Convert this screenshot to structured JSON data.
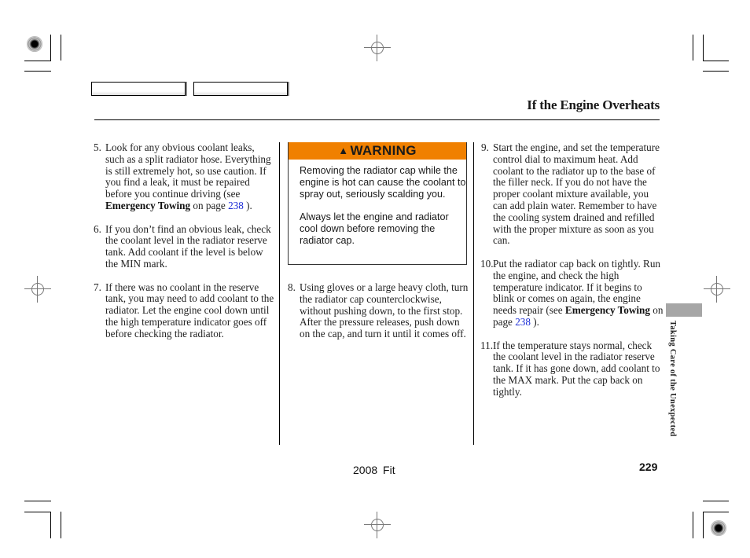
{
  "header": {
    "title": "If the Engine Overheats",
    "nav_buttons": [
      {
        "label": ""
      },
      {
        "label": ""
      }
    ]
  },
  "columns": {
    "left": [
      {
        "num": "5.",
        "parts": [
          {
            "t": "Look for any obvious coolant leaks, such as a split radiator hose. Everything is still extremely hot, so use caution. If you find a leak, it must be repaired before you continue driving (see "
          },
          {
            "b": "Emergency Towing"
          },
          {
            "t": " on page "
          },
          {
            "link": "238"
          },
          {
            "t": " )."
          }
        ]
      },
      {
        "num": "6.",
        "parts": [
          {
            "t": "If you don’t find an obvious leak, check the coolant level in the radiator reserve tank. Add coolant if the level is below the MIN mark."
          }
        ]
      },
      {
        "num": "7.",
        "parts": [
          {
            "t": "If there was no coolant in the reserve tank, you may need to add coolant to the radiator. Let the engine cool down until the high temperature indicator goes off before checking the radiator."
          }
        ]
      }
    ],
    "middle": [
      {
        "num": "8.",
        "parts": [
          {
            "t": "Using gloves or a large heavy cloth, turn the radiator cap counterclockwise, without pushing down, to the first stop. After the pressure releases, push down on the cap, and turn it until it comes off."
          }
        ]
      }
    ],
    "right": [
      {
        "num": "9.",
        "parts": [
          {
            "t": "Start the engine, and set the temperature control dial to maximum heat. Add coolant to the radiator up to the base of the filler neck. If you do not have the proper coolant mixture available, you can add plain water. Remember to have the cooling system drained and refilled with the proper mixture as soon as you can."
          }
        ]
      },
      {
        "num": "10.",
        "parts": [
          {
            "t": "Put the radiator cap back on tightly. Run the engine, and check the high temperature indicator. If it begins to blink or comes on again, the engine needs repair (see "
          },
          {
            "b": "Emergency Towing"
          },
          {
            "t": " on page "
          },
          {
            "link": "238"
          },
          {
            "t": " )."
          }
        ]
      },
      {
        "num": "11.",
        "parts": [
          {
            "t": "If the temperature stays normal, check the coolant level in the radiator reserve tank. If it has gone down, add coolant to the MAX mark. Put the cap back on tightly."
          }
        ]
      }
    ]
  },
  "warning": {
    "icon": "warning-triangle-icon",
    "title": "WARNING",
    "paragraphs": [
      "Removing the radiator cap while the engine is hot can cause the coolant to spray out, seriously scalding you.",
      "Always let the engine and radiator cool down before removing the radiator cap."
    ]
  },
  "side_tab": {
    "label": "Taking Care of the Unexpected"
  },
  "footer": {
    "model": "2008  Fit",
    "page_number": "229"
  },
  "colors": {
    "warning_orange": "#f08000",
    "link_blue": "#1a2bd6",
    "side_tab_gray": "#a6a6a6"
  }
}
